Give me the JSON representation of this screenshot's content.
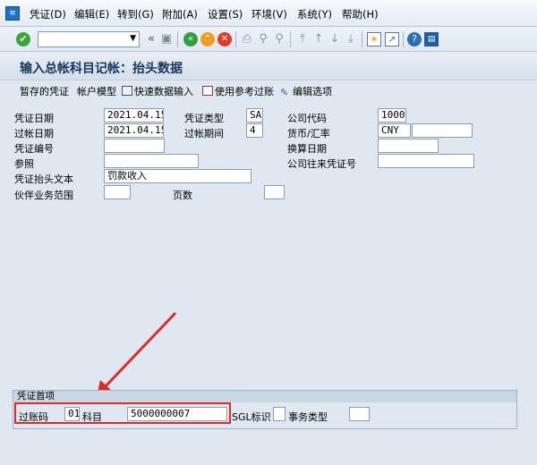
{
  "menu": {
    "items": [
      "凭证(D)",
      "编辑(E)",
      "转到(G)",
      "附加(A)",
      "设置(S)",
      "环境(V)",
      "系统(Y)",
      "帮助(H)"
    ]
  },
  "toolbar": {
    "command_field_value": "",
    "icons": [
      "check-icon",
      "back-icon",
      "save-icon",
      "back-green-icon",
      "exit-icon",
      "cancel-icon",
      "print-icon",
      "find-icon",
      "find-next-icon",
      "first-page-icon",
      "prev-page-icon",
      "next-page-icon",
      "last-page-icon",
      "new-session-icon",
      "shortcut-icon",
      "help-icon",
      "customize-icon"
    ]
  },
  "title": "输入总帐科目记帐：抬头数据",
  "app_toolbar": {
    "parked_doc": "暂存的凭证",
    "account_model": "帐户模型",
    "fast_entry": "快速数据输入",
    "post_with_ref": "使用参考过账",
    "edit_options": "编辑选项"
  },
  "form": {
    "doc_date": {
      "label": "凭证日期",
      "value": "2021.04.15"
    },
    "doc_type": {
      "label": "凭证类型",
      "value": "SA"
    },
    "company_code": {
      "label": "公司代码",
      "value": "1000"
    },
    "posting_date": {
      "label": "过帐日期",
      "value": "2021.04.15"
    },
    "period": {
      "label": "过帐期间",
      "value": "4"
    },
    "currency": {
      "label": "货币/汇率",
      "value": "CNY",
      "rate": ""
    },
    "doc_number": {
      "label": "凭证编号",
      "value": ""
    },
    "translation_date": {
      "label": "换算日期",
      "value": ""
    },
    "reference": {
      "label": "参照",
      "value": ""
    },
    "intercompany_no": {
      "label": "公司往来凭证号",
      "value": ""
    },
    "header_text": {
      "label": "凭证抬头文本",
      "value": "罚款收入"
    },
    "partner_business_area": {
      "label": "伙伴业务范围",
      "value": ""
    },
    "pages": {
      "label": "页数",
      "value": ""
    }
  },
  "first_line": {
    "group_title": "凭证首项",
    "posting_key": {
      "label": "过账码",
      "value": "01"
    },
    "account": {
      "label": "科目",
      "value": "5000000007"
    },
    "sgl": {
      "label": "SGL标识",
      "value": ""
    },
    "transaction_type": {
      "label": "事务类型",
      "value": ""
    }
  },
  "colors": {
    "background": "#dfe8f1",
    "highlight": "#e02a2a",
    "title": "#17365d"
  }
}
